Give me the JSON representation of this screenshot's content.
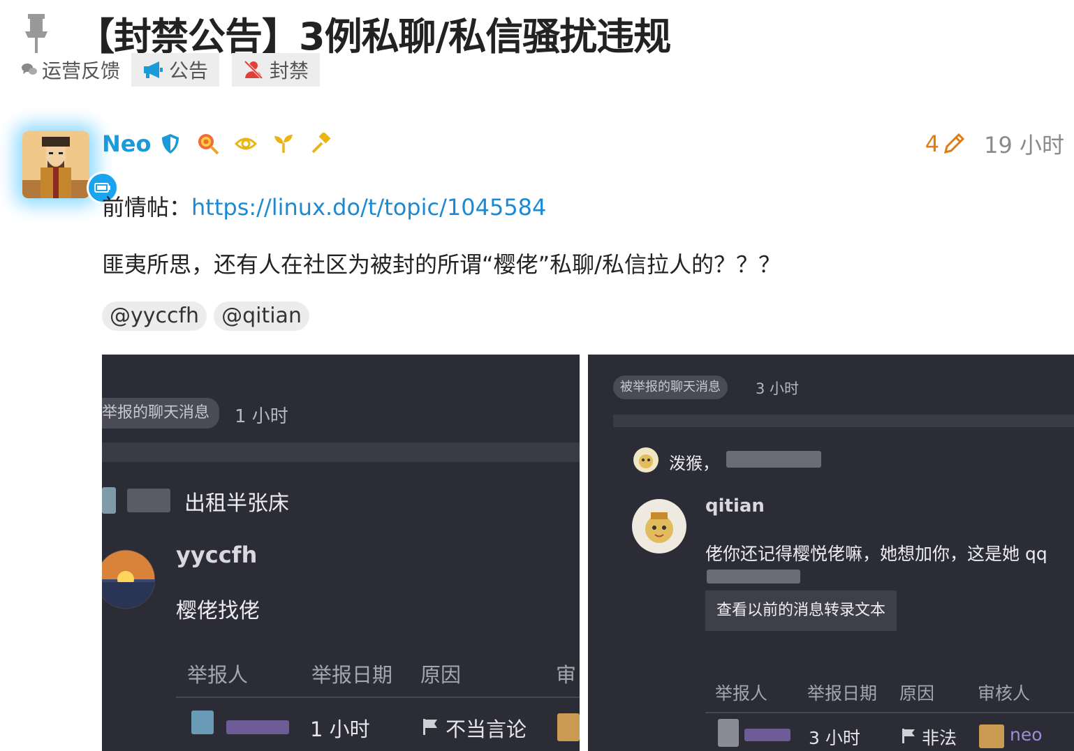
{
  "topic": {
    "title": "【封禁公告】3例私聊/私信骚扰违规",
    "category": "运营反馈",
    "tags": [
      "公告",
      "封禁"
    ]
  },
  "post": {
    "username": "Neo",
    "edit_count": "4",
    "time": "19 小时",
    "line1_prefix": "前情帖：",
    "line1_link": "https://linux.do/t/topic/1045584",
    "line2": "匪夷所思，还有人在社区为被封的所谓“樱佬”私聊/私信拉人的？？？",
    "mentions": [
      "@yyccfh",
      "@qitian"
    ],
    "badges": [
      "shield-icon",
      "lollipop-icon",
      "eye-icon",
      "sprout-icon",
      "hammer-icon"
    ]
  },
  "screenshot1": {
    "pill": "举报的聊天消息",
    "time": "1 小时",
    "message1": "出租半张床",
    "user": "yyccfh",
    "message2": "樱佬找佬",
    "headers": [
      "举报人",
      "举报日期",
      "原因",
      "审"
    ],
    "row_date": "1 小时",
    "row_reason": "不当言论"
  },
  "screenshot2": {
    "pill": "被举报的聊天消息",
    "time": "3 小时",
    "message1": "泼猴，",
    "user": "qitian",
    "message2": "佬你还记得樱悦佬嘛，她想加你，这是她 qq",
    "button": "查看以前的消息转录文本",
    "headers": [
      "举报人",
      "举报日期",
      "原因",
      "审核人"
    ],
    "row_date": "3 小时",
    "row_reason": "非法",
    "row_reviewer": "neo"
  },
  "colors": {
    "username": "#1a9ad8",
    "link": "#1b8ad2",
    "edit": "#e07d12",
    "screenshot_bg": "#2b2c36"
  }
}
